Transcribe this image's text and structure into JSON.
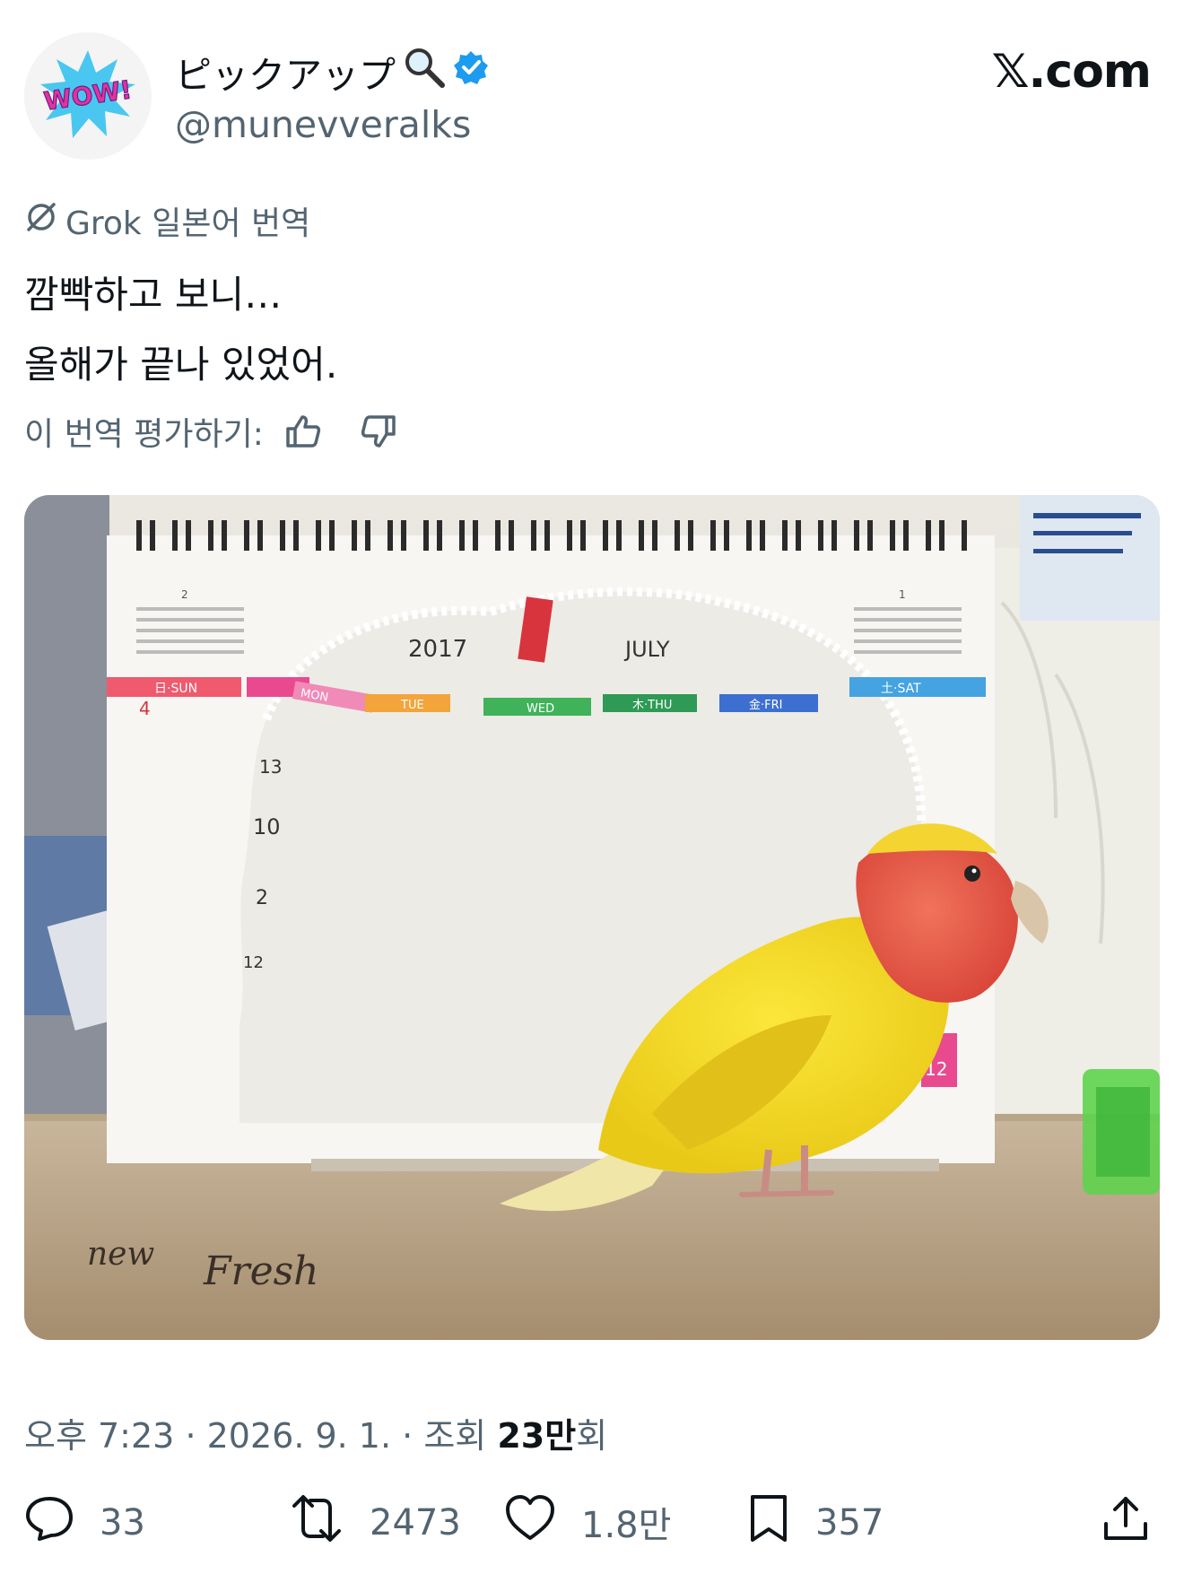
{
  "author": {
    "display_name": "ピックアップ",
    "handle": "@munevveralks",
    "avatar_text": "WOW!",
    "verified": true
  },
  "brand": "𝕏.com",
  "translation": {
    "label": "Grok 일본어 번역",
    "lines": [
      "깜빡하고 보니…",
      "올해가 끝나 있었어."
    ],
    "rate_label": "이 번역 평가하기:"
  },
  "media": {
    "calendar_texts": [
      "2017",
      "JULY",
      "日·SUN",
      "MON",
      "TUE",
      "WED",
      "木·THU",
      "金·FRI",
      "土·SAT",
      "12",
      "2",
      "1",
      "4",
      "13",
      "10",
      "2",
      "12"
    ],
    "handwriting": [
      "new",
      "Fresh"
    ]
  },
  "meta": {
    "time": "오후 7:23",
    "date": "2026. 9. 1.",
    "views_prefix": "조회",
    "views_value": "23만",
    "views_suffix": "회"
  },
  "actions": {
    "replies": "33",
    "reposts": "2473",
    "likes": "1.8만",
    "bookmarks": "357"
  },
  "colors": {
    "verified_blue": "#1d9bf0",
    "text_primary": "#0f1419",
    "text_secondary": "#536471",
    "bird_yellow": "#f2dc2a",
    "bird_face": "#e8614a"
  }
}
